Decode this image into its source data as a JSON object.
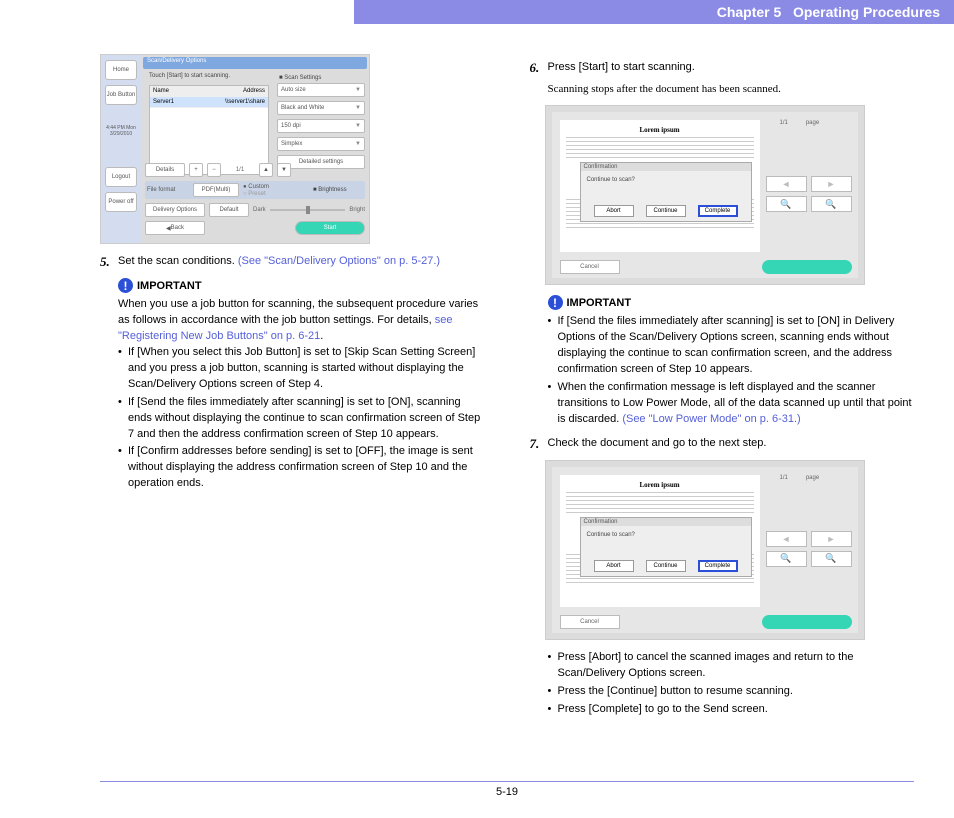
{
  "header": {
    "chapter": "Chapter 5",
    "title": "Operating Procedures"
  },
  "footer": {
    "page": "5-19"
  },
  "left": {
    "step5": {
      "num": "5.",
      "text": "Set the scan conditions. ",
      "link": "(See \"Scan/Delivery Options\" on p. 5-27.)"
    },
    "important": "IMPORTANT",
    "intro": "When you use a job button for scanning, the subsequent procedure varies as follows in accordance with the job button settings. For details, ",
    "intro_link": "see \"Registering New Job Buttons\" on p. 6-21",
    "intro_end": ".",
    "bullets": [
      "If [When you select this Job Button] is set to [Skip Scan Setting Screen] and you press a job button, scanning is started without displaying the Scan/Delivery Options screen of Step 4.",
      "If [Send the files immediately after scanning] is set to [ON], scanning ends without displaying the continue to scan confirmation screen of Step 7 and then the address confirmation screen of Step 10 appears.",
      "If [Confirm addresses before sending] is set to [OFF], the image is sent without displaying the address confirmation screen of Step 10 and the operation ends."
    ]
  },
  "right": {
    "step6": {
      "num": "6.",
      "text": "Press [Start] to start scanning.",
      "sub": "Scanning stops after the document has been scanned."
    },
    "important": "IMPORTANT",
    "bullets6": [
      {
        "text": "If [Send the files immediately after scanning] is set to [ON] in Delivery Options of the Scan/Delivery Options screen, scanning ends without displaying the continue to scan confirmation screen, and the address confirmation screen of Step 10 appears."
      },
      {
        "text": "When the confirmation message is left displayed and the scanner transitions to Low Power Mode, all of the data scanned up until that point is discarded. ",
        "link": "(See \"Low Power Mode\" on p. 6-31.)"
      }
    ],
    "step7": {
      "num": "7.",
      "text": "Check the document and go to the next step."
    },
    "bullets7": [
      "Press [Abort] to cancel the scanned images and return to the Scan/Delivery Options screen.",
      "Press the [Continue] button to resume scanning.",
      "Press [Complete] to go to the Send screen."
    ]
  },
  "fig1": {
    "topbar": "Scan/Delivery Options",
    "msg": "Touch [Start] to start scanning.",
    "side": {
      "home": "Home",
      "job": "Job Button",
      "time": "4:44 PM Mon 3/29/2010",
      "logout": "Logout",
      "power": "Power off"
    },
    "list_header_l": "Name",
    "list_header_r": "Address",
    "list_row_l": "Server1",
    "list_row_r": "\\\\server1\\share",
    "right_label": "Scan Settings",
    "r1": "Auto size",
    "r2": "Black and White",
    "r3": "150 dpi",
    "r4": "Simplex",
    "r5": "Detailed settings",
    "bot_details": "Details",
    "bot_page": "1/1",
    "fs_label": "File format",
    "fs_default": "PDF(Multi)",
    "preset": "Preset",
    "custom": "Custom",
    "delivery_btn": "Delivery Options",
    "default_btn": "Default",
    "bright_label": "Brightness",
    "dark": "Dark",
    "bright": "Bright",
    "back": "Back",
    "start": "Start"
  },
  "fig2": {
    "title": "Lorem ipsum",
    "page_l": "1/1",
    "page_r": "page",
    "dialog_title": "Confirmation",
    "dialog_q": "Continue to scan?",
    "abort": "Abort",
    "cont": "Continue",
    "complete": "Complete",
    "cancel": "Cancel"
  }
}
